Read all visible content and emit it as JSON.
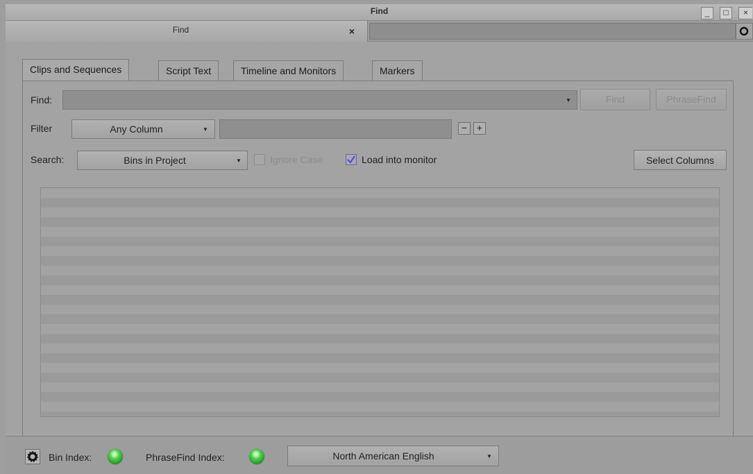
{
  "window": {
    "title": "Find",
    "minimize": "_",
    "maximize": "□",
    "close": "×"
  },
  "doc_tab": {
    "label": "Find",
    "close": "×"
  },
  "tabs": [
    {
      "label": "Clips and Sequences",
      "active": true
    },
    {
      "label": "Script Text",
      "active": false
    },
    {
      "label": "Timeline and Monitors",
      "active": false
    },
    {
      "label": "Markers",
      "active": false
    }
  ],
  "find_row": {
    "label": "Find:",
    "value": "",
    "find_button": "Find",
    "phrasefind_button": "PhraseFind"
  },
  "filter_row": {
    "label": "Filter",
    "column_select": "Any Column",
    "value": "",
    "remove": "−",
    "add": "+"
  },
  "search_row": {
    "label": "Search:",
    "scope_select": "Bins in Project",
    "ignore_case": {
      "label": "Ignore Case",
      "checked": false,
      "enabled": false
    },
    "load_into_monitor": {
      "label": "Load into monitor",
      "checked": true
    },
    "select_columns": "Select Columns"
  },
  "results": {
    "rows": []
  },
  "status": {
    "bin_index_label": "Bin Index:",
    "phrasefind_index_label": "PhraseFind Index:",
    "language_select": "North American English",
    "indicator_color": "#3cc53c"
  }
}
